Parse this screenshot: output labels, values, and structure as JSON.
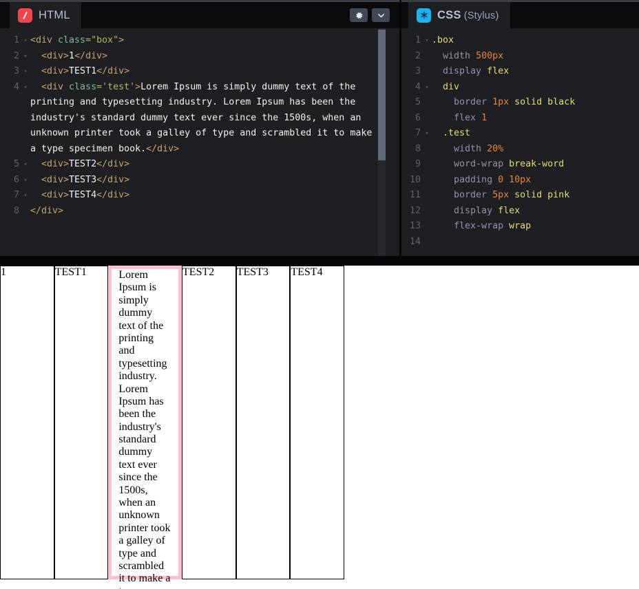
{
  "editors": {
    "html_pane": {
      "tab_label": "HTML",
      "tab_icon": "slash-icon",
      "buttons": [
        {
          "name": "settings-gear-button",
          "icon": "gear-icon"
        },
        {
          "name": "collapse-button",
          "icon": "chevron-down-icon"
        }
      ],
      "lines": [
        {
          "num": "1",
          "fold": "▾"
        },
        {
          "num": "2",
          "fold": "▾"
        },
        {
          "num": "3",
          "fold": "▾"
        },
        {
          "num": "4",
          "fold": "▾"
        },
        {
          "num": "5",
          "fold": "▾"
        },
        {
          "num": "6",
          "fold": "▾"
        },
        {
          "num": "7",
          "fold": "▾"
        },
        {
          "num": "8",
          "fold": ""
        }
      ],
      "code": {
        "l1": {
          "tag_open": "<div ",
          "attr": "class",
          "str": "=\"box\"",
          "tag_close": ">"
        },
        "l2": {
          "tag_open": "<div>",
          "text": "1",
          "tag_close": "</div>"
        },
        "l3": {
          "tag_open": "<div>",
          "text": "TEST1",
          "tag_close": "</div>"
        },
        "l4": {
          "tag_open": "<div ",
          "attr": "class",
          "str": "='test'",
          "gt": ">",
          "text": "Lorem Ipsum is simply dummy text of the printing and typesetting industry. Lorem Ipsum has been the industry's standard dummy text ever since the 1500s, when an unknown printer took a galley of type and scrambled it to make a type specimen book.",
          "tag_close": "</div>"
        },
        "l5": {
          "tag_open": "<div>",
          "text": "TEST2",
          "tag_close": "</div>"
        },
        "l6": {
          "tag_open": "<div>",
          "text": "TEST3",
          "tag_close": "</div>"
        },
        "l7": {
          "tag_open": "<div>",
          "text": "TEST4",
          "tag_close": "</div>"
        },
        "l8": {
          "tag_close": "</div>"
        }
      }
    },
    "css_pane": {
      "tab_label": "CSS",
      "tab_sublabel": " (Stylus)",
      "tab_icon": "asterisk-icon",
      "lines": [
        {
          "num": "1",
          "fold": "▾"
        },
        {
          "num": "2",
          "fold": ""
        },
        {
          "num": "3",
          "fold": ""
        },
        {
          "num": "4",
          "fold": "▾"
        },
        {
          "num": "5",
          "fold": ""
        },
        {
          "num": "6",
          "fold": ""
        },
        {
          "num": "7",
          "fold": "▾"
        },
        {
          "num": "8",
          "fold": ""
        },
        {
          "num": "9",
          "fold": ""
        },
        {
          "num": "10",
          "fold": ""
        },
        {
          "num": "11",
          "fold": ""
        },
        {
          "num": "12",
          "fold": ""
        },
        {
          "num": "13",
          "fold": ""
        },
        {
          "num": "14",
          "fold": ""
        }
      ],
      "code": {
        "l1": {
          "sel": ".box"
        },
        "l2": {
          "prop": "width",
          "num": "500px"
        },
        "l3": {
          "prop": "display",
          "val": "flex"
        },
        "l4": {
          "sel": "div"
        },
        "l5": {
          "prop": "border",
          "num": "1px",
          "val": "solid black"
        },
        "l6": {
          "prop": "flex",
          "num": "1"
        },
        "l7": {
          "sel": ".test"
        },
        "l8": {
          "prop": "width",
          "num": "20%"
        },
        "l9": {
          "prop": "word-wrap",
          "val": "break-word"
        },
        "l10": {
          "prop": "padding",
          "num": "0 10px"
        },
        "l11": {
          "prop": "border",
          "num": "5px",
          "val": "solid pink"
        },
        "l12": {
          "prop": "display",
          "val": "flex"
        },
        "l13": {
          "prop": "flex-wrap",
          "val": "wrap"
        },
        "l14": {
          "empty": ""
        }
      }
    }
  },
  "preview": {
    "cells": [
      {
        "name": "preview-cell-1",
        "text": "1",
        "kind": "plain"
      },
      {
        "name": "preview-cell-test1",
        "text": "TEST1",
        "kind": "plain"
      },
      {
        "name": "preview-cell-test",
        "text": "Lorem Ipsum is simply dummy text of the printing and typesetting industry. Lorem Ipsum has been the industry's standard dummy text ever since the 1500s, when an unknown printer took a galley of type and scrambled it to make a type specimen book.",
        "kind": "test"
      },
      {
        "name": "preview-cell-test2",
        "text": "TEST2",
        "kind": "plain"
      },
      {
        "name": "preview-cell-test3",
        "text": "TEST3",
        "kind": "plain"
      },
      {
        "name": "preview-cell-test4",
        "text": "TEST4",
        "kind": "plain"
      }
    ]
  },
  "colors": {
    "html_tab_accent": "#f4454a",
    "css_tab_accent": "#19b4f0",
    "editor_bg": "#1d1f23",
    "header_bg": "#0b0b0d",
    "test_border": "pink",
    "cell_border": "black"
  }
}
